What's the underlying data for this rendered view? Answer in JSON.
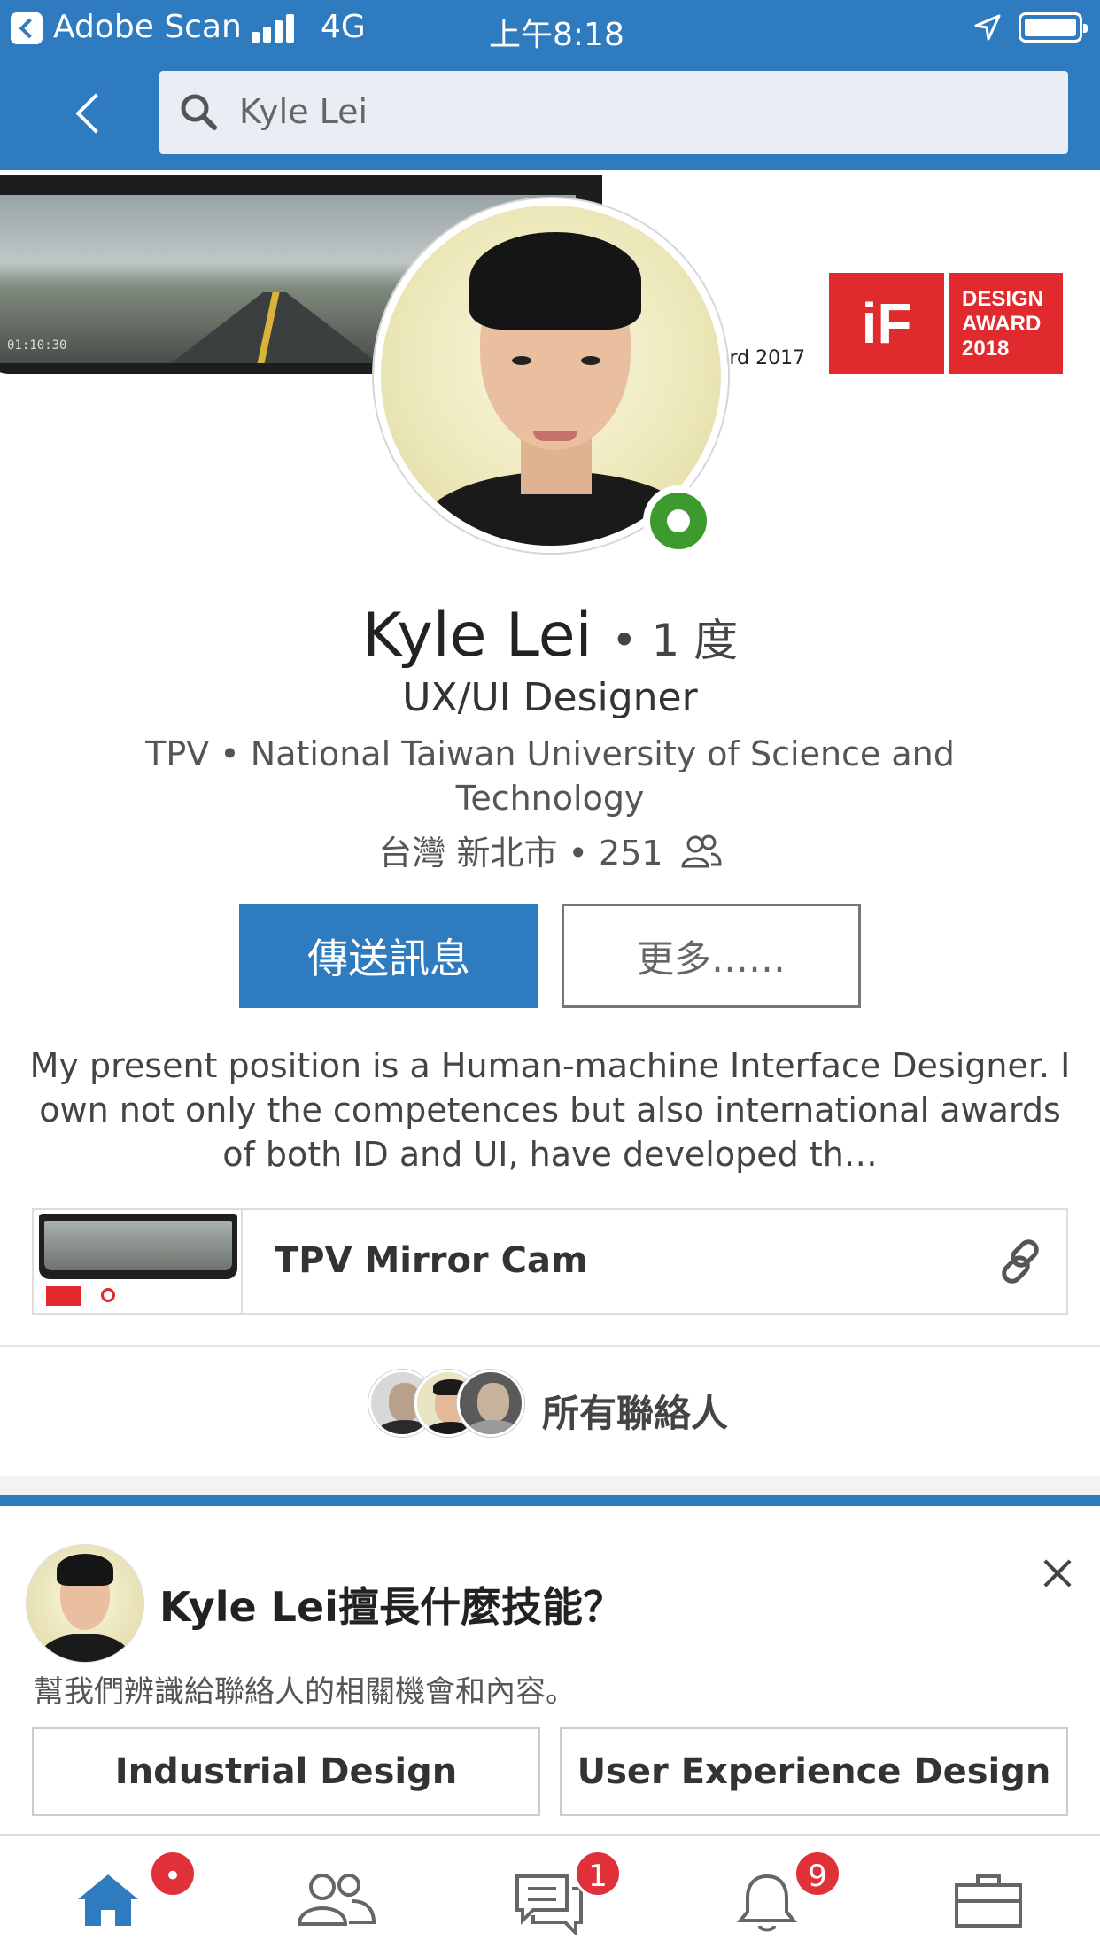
{
  "status_bar": {
    "app_name": "Adobe Scan",
    "network": "4G",
    "time": "上午8:18"
  },
  "search": {
    "value": "Kyle Lei"
  },
  "banner": {
    "award_text": "ard 2017",
    "if_logo_mark": "iF",
    "if_award_lines": [
      "DESIGN",
      "AWARD",
      "2018"
    ],
    "mirror_readout": "01:10:30"
  },
  "profile": {
    "name": "Kyle Lei",
    "degree": "• 1 度",
    "headline": "UX/UI Designer",
    "subline": "TPV • National Taiwan University of Science and Technology",
    "location": "台灣 新北市 • 251"
  },
  "actions": {
    "message_label": "傳送訊息",
    "more_label": "更多……"
  },
  "summary": {
    "text": "My present position is a Human-machine Interface Designer. I own not only the competences but also international awards of both ID and UI, have developed th…"
  },
  "media": {
    "title": "TPV Mirror Cam"
  },
  "connections": {
    "label": "所有聯絡人"
  },
  "skills": {
    "question": "Kyle Lei擅長什麼技能？",
    "subtitle": "幫我們辨識給聯絡人的相關機會和內容。",
    "options": [
      "Industrial Design",
      "User Experience Design"
    ]
  },
  "tabs": {
    "home_badge": "•",
    "messages_badge": "1",
    "notifications_badge": "9"
  },
  "colors": {
    "brand_blue": "#2f7bbf",
    "online_green": "#3d9a2c",
    "badge_red": "#e0303a",
    "if_red": "#e02a2e"
  }
}
